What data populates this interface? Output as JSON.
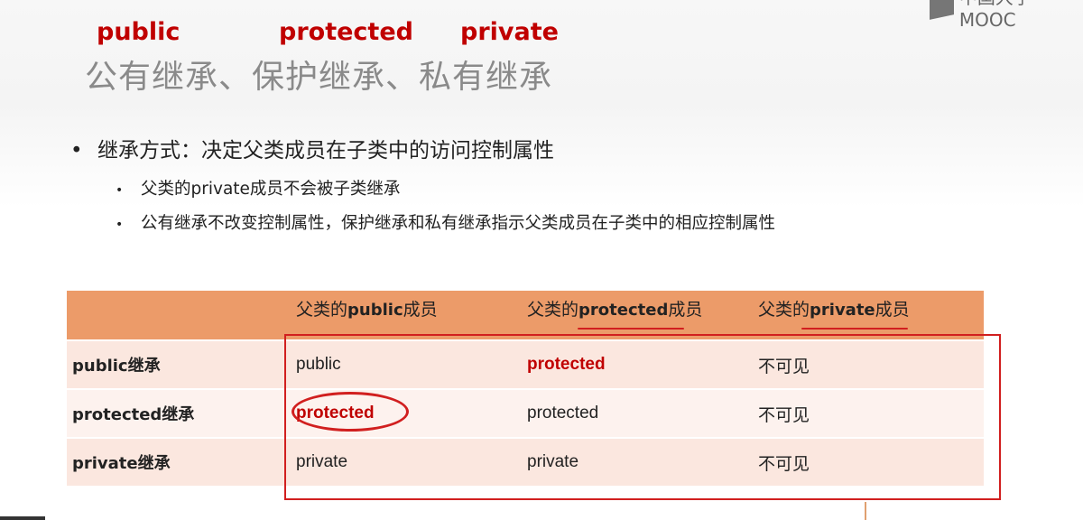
{
  "watermark": "中国大学MOOC",
  "keywords": {
    "public": "public",
    "protected": "protected",
    "private": "private"
  },
  "title": "公有继承、保护继承、私有继承",
  "bullet_main": "继承方式：决定父类成员在子类中的访问控制属性",
  "sub_bullets": [
    "父类的private成员不会被子类继承",
    "公有继承不改变控制属性，保护继承和私有继承指示父类成员在子类中的相应控制属性"
  ],
  "table": {
    "headers": [
      {
        "pre": "",
        "mid": "",
        "post": ""
      },
      {
        "pre": "父类的",
        "mid": "public",
        "post": "成员"
      },
      {
        "pre": "父类的",
        "mid": "protected",
        "post": "成员"
      },
      {
        "pre": "父类的",
        "mid": "private",
        "post": "成员"
      }
    ],
    "rows": [
      [
        "public继承",
        "public",
        "protected",
        "不可见"
      ],
      [
        "protected继承",
        "protected",
        "protected",
        "不可见"
      ],
      [
        "private继承",
        "private",
        "private",
        "不可见"
      ]
    ]
  },
  "colors": {
    "accent_red": "#c00000",
    "header_bg": "#ec9b69",
    "annotation_red": "#d11f1f"
  }
}
